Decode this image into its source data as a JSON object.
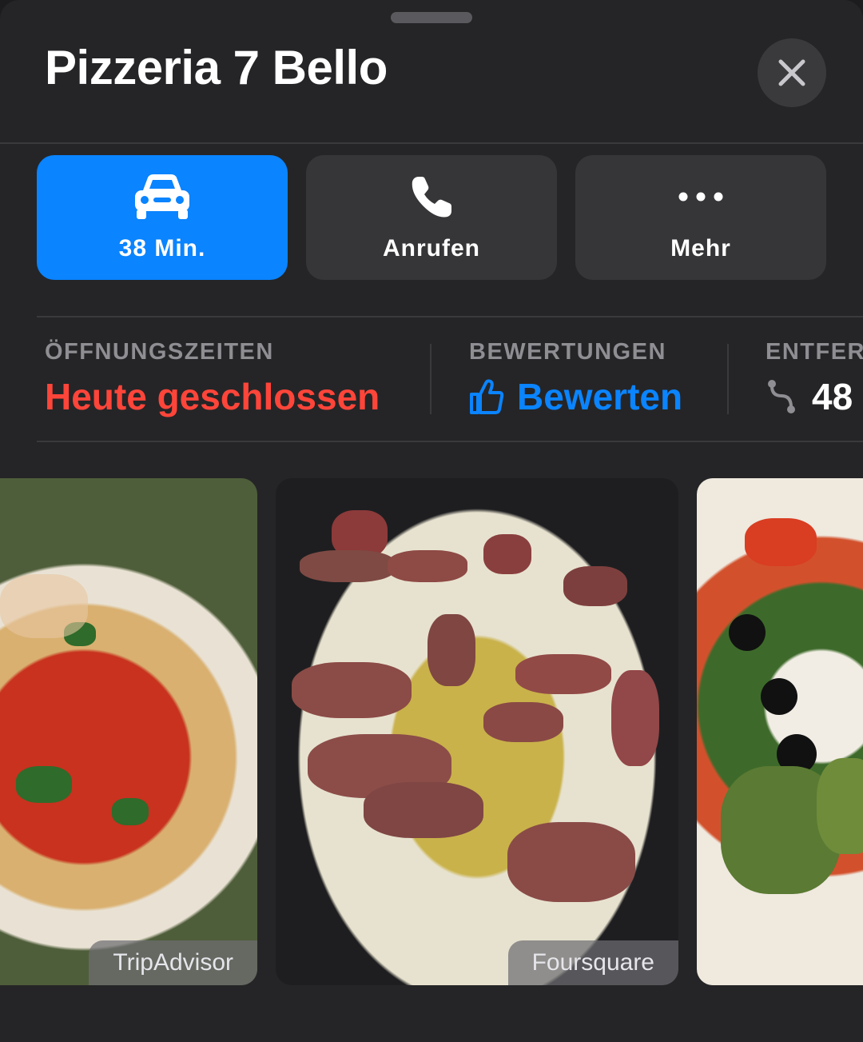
{
  "header": {
    "title": "Pizzeria 7 Bello",
    "close_icon": "close-icon"
  },
  "actions": [
    {
      "label": "38 Min.",
      "icon": "car-icon",
      "primary": true
    },
    {
      "label": "Anrufen",
      "icon": "phone-icon",
      "primary": false
    },
    {
      "label": "Mehr",
      "icon": "more-icon",
      "primary": false
    }
  ],
  "info": {
    "hours": {
      "heading": "ÖFFNUNGSZEITEN",
      "value": "Heute geschlossen"
    },
    "ratings": {
      "heading": "BEWERTUNGEN",
      "value": "Bewerten",
      "icon": "thumbs-up-icon"
    },
    "distance": {
      "heading": "ENTFER",
      "value": "48",
      "icon": "route-icon"
    }
  },
  "photos": [
    {
      "subject": "pizza",
      "source": "TripAdvisor"
    },
    {
      "subject": "steak",
      "source": "Foursquare"
    },
    {
      "subject": "salad",
      "source": ""
    }
  ],
  "colors": {
    "accent": "#0a84ff",
    "closed": "#ff453a",
    "background": "#252527"
  }
}
